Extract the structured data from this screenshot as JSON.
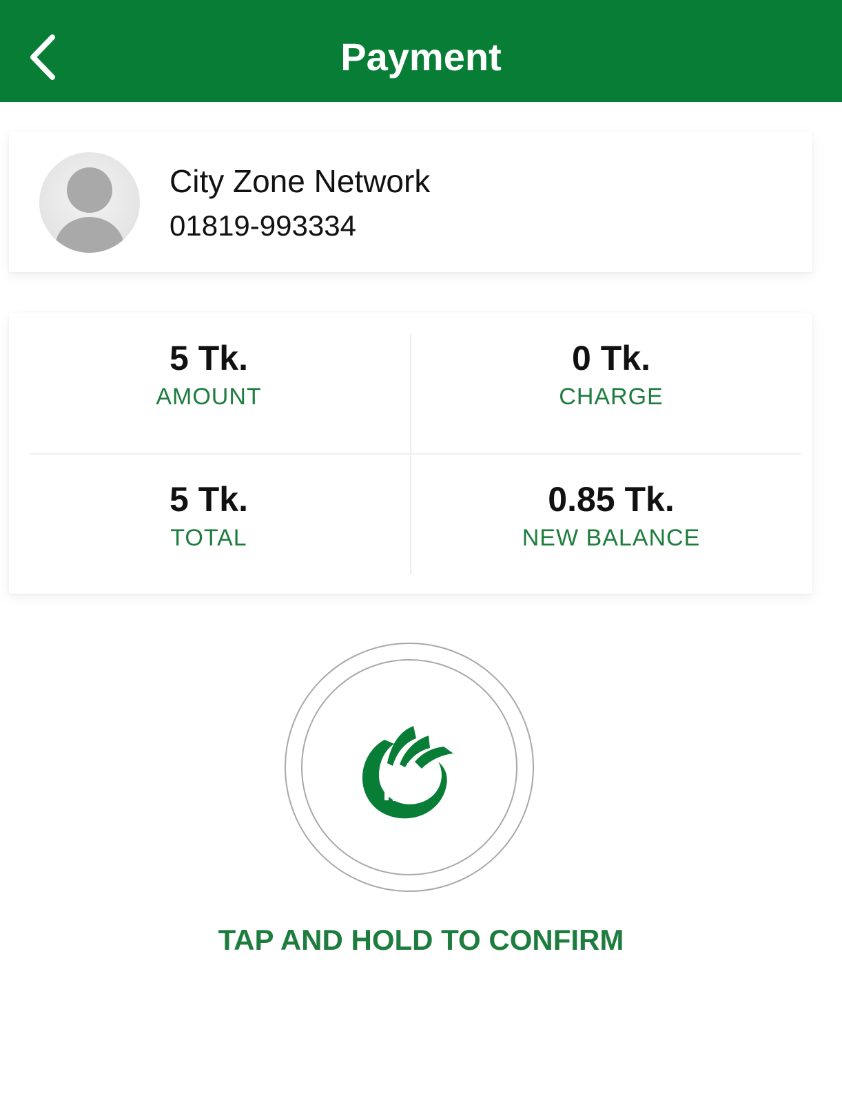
{
  "header": {
    "title": "Payment",
    "back_icon": "chevron-left-icon",
    "background_color": "#087d36"
  },
  "recipient": {
    "avatar_icon": "default-avatar-icon",
    "name": "City Zone Network",
    "phone": "01819-993334"
  },
  "summary": {
    "amount": {
      "value": "5 Tk.",
      "label": "AMOUNT"
    },
    "charge": {
      "value": "0 Tk.",
      "label": "CHARGE"
    },
    "total": {
      "value": "5 Tk.",
      "label": "TOTAL"
    },
    "new_balance": {
      "value": "0.85 Tk.",
      "label": "NEW BALANCE"
    }
  },
  "confirm": {
    "logo_icon": "brand-logo-icon",
    "label": "TAP AND HOLD TO CONFIRM",
    "accent_color": "#1e7d3e"
  }
}
